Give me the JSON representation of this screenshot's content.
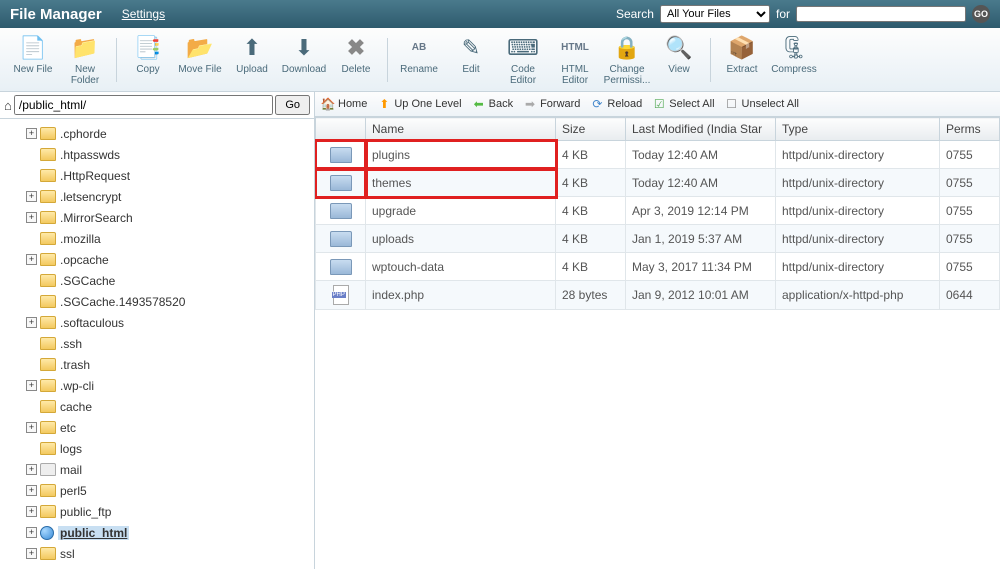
{
  "header": {
    "title": "File Manager",
    "settings": "Settings",
    "search_label": "Search",
    "scope_selected": "All Your Files",
    "for_label": "for",
    "go": "GO"
  },
  "toolbar": [
    {
      "id": "new-file",
      "label": "New File",
      "icon": "📄"
    },
    {
      "id": "new-folder",
      "label": "New Folder",
      "icon": "📁"
    },
    {
      "id": "sep"
    },
    {
      "id": "copy",
      "label": "Copy",
      "icon": "📑"
    },
    {
      "id": "move-file",
      "label": "Move File",
      "icon": "📂"
    },
    {
      "id": "upload",
      "label": "Upload",
      "icon": "⬆"
    },
    {
      "id": "download",
      "label": "Download",
      "icon": "⬇"
    },
    {
      "id": "delete",
      "label": "Delete",
      "icon": "✖"
    },
    {
      "id": "sep"
    },
    {
      "id": "rename",
      "label": "Rename",
      "icon": "AB"
    },
    {
      "id": "edit",
      "label": "Edit",
      "icon": "✎"
    },
    {
      "id": "code-editor",
      "label": "Code Editor",
      "icon": "⌨"
    },
    {
      "id": "html-editor",
      "label": "HTML Editor",
      "icon": "HTML"
    },
    {
      "id": "change-perms",
      "label": "Change Permissi...",
      "icon": "🔒"
    },
    {
      "id": "view",
      "label": "View",
      "icon": "🔍"
    },
    {
      "id": "sep"
    },
    {
      "id": "extract",
      "label": "Extract",
      "icon": "📦"
    },
    {
      "id": "compress",
      "label": "Compress",
      "icon": "🗜"
    }
  ],
  "pathbar": {
    "path": "/public_html/",
    "go": "Go"
  },
  "tree": [
    {
      "indent": 1,
      "exp": "+",
      "label": ".cphorde"
    },
    {
      "indent": 1,
      "exp": "",
      "label": ".htpasswds"
    },
    {
      "indent": 1,
      "exp": "",
      "label": ".HttpRequest"
    },
    {
      "indent": 1,
      "exp": "+",
      "label": ".letsencrypt"
    },
    {
      "indent": 1,
      "exp": "+",
      "label": ".MirrorSearch"
    },
    {
      "indent": 1,
      "exp": "",
      "label": ".mozilla"
    },
    {
      "indent": 1,
      "exp": "+",
      "label": ".opcache"
    },
    {
      "indent": 1,
      "exp": "",
      "label": ".SGCache"
    },
    {
      "indent": 1,
      "exp": "",
      "label": ".SGCache.1493578520"
    },
    {
      "indent": 1,
      "exp": "+",
      "label": ".softaculous"
    },
    {
      "indent": 1,
      "exp": "",
      "label": ".ssh"
    },
    {
      "indent": 1,
      "exp": "",
      "label": ".trash"
    },
    {
      "indent": 1,
      "exp": "+",
      "label": ".wp-cli"
    },
    {
      "indent": 1,
      "exp": "",
      "label": "cache"
    },
    {
      "indent": 1,
      "exp": "+",
      "label": "etc"
    },
    {
      "indent": 1,
      "exp": "",
      "label": "logs"
    },
    {
      "indent": 1,
      "exp": "+",
      "label": "mail",
      "icoClass": "mail"
    },
    {
      "indent": 1,
      "exp": "+",
      "label": "perl5"
    },
    {
      "indent": 1,
      "exp": "+",
      "label": "public_ftp",
      "icoClass": "lock"
    },
    {
      "indent": 1,
      "exp": "+",
      "label": "public_html",
      "icoClass": "globe",
      "selected": true
    },
    {
      "indent": 1,
      "exp": "+",
      "label": "ssl"
    }
  ],
  "navbar": [
    {
      "id": "home",
      "label": "Home",
      "icon": "🏠",
      "color": "#5a8"
    },
    {
      "id": "up",
      "label": "Up One Level",
      "icon": "⬆",
      "color": "#f90"
    },
    {
      "id": "back",
      "label": "Back",
      "icon": "⬅",
      "color": "#5b4"
    },
    {
      "id": "forward",
      "label": "Forward",
      "icon": "➡",
      "color": "#aaa"
    },
    {
      "id": "reload",
      "label": "Reload",
      "icon": "⟳",
      "color": "#48c"
    },
    {
      "id": "select-all",
      "label": "Select All",
      "icon": "☑",
      "color": "#5a5"
    },
    {
      "id": "unselect-all",
      "label": "Unselect All",
      "icon": "☐",
      "color": "#888"
    }
  ],
  "columns": [
    "Name",
    "Size",
    "Last Modified (India Star",
    "Type",
    "Perms"
  ],
  "rows": [
    {
      "ico": "folder",
      "name": "plugins",
      "size": "4 KB",
      "mod": "Today 12:40 AM",
      "type": "httpd/unix-directory",
      "perms": "0755",
      "hl": true
    },
    {
      "ico": "folder",
      "name": "themes",
      "size": "4 KB",
      "mod": "Today 12:40 AM",
      "type": "httpd/unix-directory",
      "perms": "0755",
      "hl": true,
      "alt": true
    },
    {
      "ico": "folder",
      "name": "upgrade",
      "size": "4 KB",
      "mod": "Apr 3, 2019 12:14 PM",
      "type": "httpd/unix-directory",
      "perms": "0755"
    },
    {
      "ico": "folder",
      "name": "uploads",
      "size": "4 KB",
      "mod": "Jan 1, 2019 5:37 AM",
      "type": "httpd/unix-directory",
      "perms": "0755",
      "alt": true
    },
    {
      "ico": "folder",
      "name": "wptouch-data",
      "size": "4 KB",
      "mod": "May 3, 2017 11:34 PM",
      "type": "httpd/unix-directory",
      "perms": "0755"
    },
    {
      "ico": "php",
      "name": "index.php",
      "size": "28 bytes",
      "mod": "Jan 9, 2012 10:01 AM",
      "type": "application/x-httpd-php",
      "perms": "0644",
      "alt": true
    }
  ]
}
